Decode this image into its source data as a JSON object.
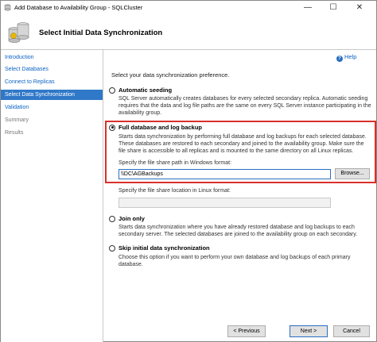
{
  "window": {
    "title": "Add Database to Availability Group - SQLCluster",
    "minimize_glyph": "—",
    "maximize_glyph": "☐",
    "close_glyph": "✕"
  },
  "header": {
    "heading": "Select Initial Data Synchronization"
  },
  "sidebar": {
    "items": [
      {
        "label": "Introduction",
        "state": "link"
      },
      {
        "label": "Select Databases",
        "state": "link"
      },
      {
        "label": "Connect to Replicas",
        "state": "link"
      },
      {
        "label": "Select Data Synchronization",
        "state": "active"
      },
      {
        "label": "Validation",
        "state": "link"
      },
      {
        "label": "Summary",
        "state": "disabled"
      },
      {
        "label": "Results",
        "state": "disabled"
      }
    ]
  },
  "content": {
    "help_label": "Help",
    "prompt": "Select your data synchronization preference.",
    "options": [
      {
        "label": "Automatic seeding",
        "selected": false,
        "description": "SQL Server automatically creates databases for every selected secondary replica. Automatic seeding requires that the data and log file paths are the same on every SQL Server instance participating in the availability group."
      },
      {
        "label": "Full database and log backup",
        "selected": true,
        "description": "Starts data synchronization by performing full database and log backups for each selected database. These databases are restored to each secondary and joined to the availability group. Make sure the file share is accessible to all replicas and is mounted to the same directory on all Linux replicas."
      },
      {
        "label": "Join only",
        "selected": false,
        "description": "Starts data synchronization where you have already restored database and log backups to each secondary server. The selected databases are joined to the availability group on each secondary."
      },
      {
        "label": "Skip initial data synchronization",
        "selected": false,
        "description": "Choose this option if you want to perform your own database and log backups of each primary database."
      }
    ],
    "windows_path_label": "Specify the file share path in Windows format:",
    "windows_path_value": "\\\\DC\\AGBackups",
    "browse_label": "Browse...",
    "linux_path_label": "Specify the file share location in Linux format:",
    "linux_path_value": ""
  },
  "footer": {
    "previous_label": "< Previous",
    "next_label": "Next >",
    "cancel_label": "Cancel"
  },
  "colors": {
    "accent": "#3078c8",
    "link": "#0b63c4",
    "highlight_border": "#d9302c"
  }
}
